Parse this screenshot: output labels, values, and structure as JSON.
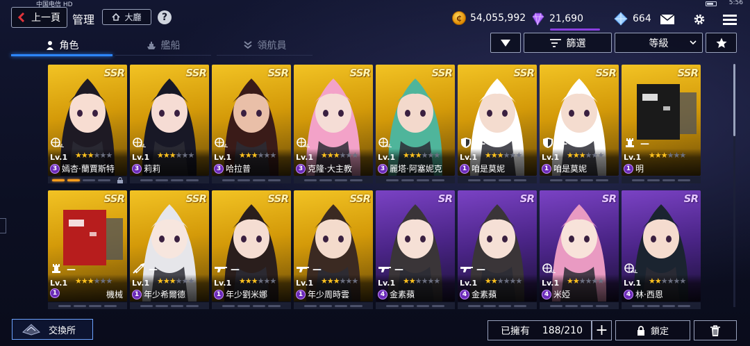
{
  "status_bar": {
    "carrier": "中国电信 HD",
    "time": "5:56"
  },
  "header": {
    "back_label": "上一頁",
    "title": "管理",
    "lobby_label": "大廳",
    "help_label": "?"
  },
  "resources": {
    "coins": "54,055,992",
    "gems": "21,690",
    "diamonds": "664"
  },
  "tabs": [
    {
      "label": "角色",
      "active": true
    },
    {
      "label": "艦船",
      "active": false
    },
    {
      "label": "領航員",
      "active": false
    }
  ],
  "controls": {
    "filter_label": "篩選",
    "sort_label": "等級"
  },
  "cards": [
    {
      "rarity": "SSR",
      "level": "Lv.1",
      "stars": 3,
      "awakening": "3",
      "name": "嫣杏·蘭賈斯特",
      "role": "all",
      "row": 0
    },
    {
      "rarity": "SSR",
      "level": "Lv.1",
      "stars": 3,
      "awakening": "3",
      "name": "莉莉",
      "role": "all",
      "row": 0
    },
    {
      "rarity": "SSR",
      "level": "Lv.1",
      "stars": 3,
      "awakening": "3",
      "name": "哈拉普",
      "role": "all",
      "row": 0
    },
    {
      "rarity": "SSR",
      "level": "Lv.1",
      "stars": 3,
      "awakening": "3",
      "name": "克隆·大主教",
      "role": "all",
      "row": 0
    },
    {
      "rarity": "SSR",
      "level": "Lv.1",
      "stars": 3,
      "awakening": "3",
      "name": "麗塔·阿塞妮克",
      "role": "all",
      "row": 0
    },
    {
      "rarity": "SSR",
      "level": "Lv.1",
      "stars": 3,
      "awakening": "1",
      "name": "咱是莫妮",
      "role": "shield",
      "row": 0
    },
    {
      "rarity": "SSR",
      "level": "Lv.1",
      "stars": 3,
      "awakening": "1",
      "name": "咱是莫妮",
      "role": "shield",
      "row": 0
    },
    {
      "rarity": "SSR",
      "level": "Lv.1",
      "stars": 3,
      "awakening": "1",
      "name": "明",
      "role": "rook",
      "row": 0
    },
    {
      "rarity": "SSR",
      "level": "Lv.1",
      "stars": 3,
      "awakening": "1",
      "name": "機械",
      "role": "rook",
      "row": 1
    },
    {
      "rarity": "SSR",
      "level": "Lv.1",
      "stars": 3,
      "awakening": "1",
      "name": "年少希爾德",
      "role": "sword",
      "row": 1
    },
    {
      "rarity": "SSR",
      "level": "Lv.1",
      "stars": 3,
      "awakening": "1",
      "name": "年少劉米娜",
      "role": "gun",
      "row": 1
    },
    {
      "rarity": "SSR",
      "level": "Lv.1",
      "stars": 3,
      "awakening": "1",
      "name": "年少周時雲",
      "role": "gun",
      "row": 1
    },
    {
      "rarity": "SR",
      "level": "Lv.1",
      "stars": 2,
      "awakening": "4",
      "name": "金素蘋",
      "role": "gun",
      "row": 1
    },
    {
      "rarity": "SR",
      "level": "Lv.1",
      "stars": 2,
      "awakening": "4",
      "name": "金素蘋",
      "role": "gun",
      "row": 1
    },
    {
      "rarity": "SR",
      "level": "Lv.1",
      "stars": 2,
      "awakening": "4",
      "name": "米婭",
      "role": "all",
      "row": 1
    },
    {
      "rarity": "SR",
      "level": "Lv.1",
      "stars": 2,
      "awakening": "4",
      "name": "林·西恩",
      "role": "all",
      "row": 1
    }
  ],
  "first_card_progress": 2,
  "footer": {
    "exchange_label": "交換所",
    "owned_label": "已擁有",
    "owned_count": "188/210",
    "lock_label": "鎖定"
  },
  "colors": {
    "accent_blue": "#2d86ff",
    "ssr_gold": "#e3ac12",
    "sr_purple": "#6a35b0"
  }
}
